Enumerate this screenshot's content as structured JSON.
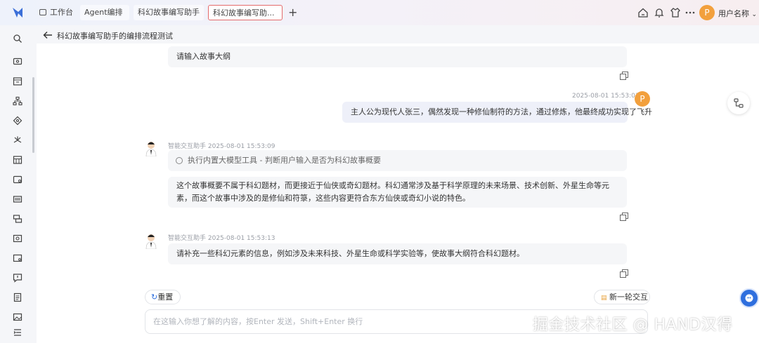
{
  "topbar": {
    "tabs": [
      {
        "label": "工作台"
      },
      {
        "label": "Agent编排"
      },
      {
        "label": "科幻故事编写助手"
      },
      {
        "label": "科幻故事编写助..."
      }
    ],
    "add_tab_label": "+",
    "user": {
      "avatar_letter": "P",
      "name": "用户名称"
    },
    "icons": [
      "home-icon",
      "bell-icon",
      "shirt-icon",
      "more-icon"
    ]
  },
  "sidebar": {
    "icons": [
      "search-icon",
      "monitor-icon",
      "calendar-icon",
      "org-chart-icon",
      "layers-icon",
      "fan-icon",
      "grid-calendar-icon",
      "mail-card-icon",
      "barcode-icon",
      "stack-icon",
      "camera-box-icon",
      "image-box-icon",
      "chat-box-icon",
      "document-icon",
      "picture-icon",
      "menu-collapse-icon"
    ]
  },
  "header": {
    "title": "科幻故事编写助手的编排流程测试"
  },
  "chat": {
    "prompt_message": "请输入故事大纲",
    "user_message": {
      "time": "2025-08-01 15:53:03",
      "text": "主人公为现代人张三，偶然发现一种修仙制符的方法，通过修炼，他最终成功实现了飞升",
      "avatar_letter": "P"
    },
    "bot1": {
      "meta": "智能交互助手 2025-08-01 15:53:09",
      "tool": "执行内置大模型工具 - 判断用户输入是否为科幻故事概要",
      "text": "这个故事概要不属于科幻题材，而更接近于仙侠或奇幻题材。科幻通常涉及基于科学原理的未来场景、技术创新、外星生命等元素，而这个故事中涉及的是修仙和符箓，这些内容更符合东方仙侠或奇幻小说的特色。"
    },
    "bot2": {
      "meta": "智能交互助手 2025-08-01 15:53:13",
      "text": "请补充一些科幻元素的信息，例如涉及未来科技、外星生命或科学实验等，使故事大纲符合科幻题材。"
    }
  },
  "actions": {
    "reset_label": "重置",
    "new_round_label": "新一轮交互"
  },
  "input": {
    "placeholder": "在这输入你想了解的内容，按Enter 发送，Shift+Enter 换行"
  },
  "watermark": "掘金技术社区 @ HAND汉得",
  "colors": {
    "accent": "#2f6fde",
    "avatar": "#f2a03d",
    "active_tab_border": "#e46b6b"
  }
}
